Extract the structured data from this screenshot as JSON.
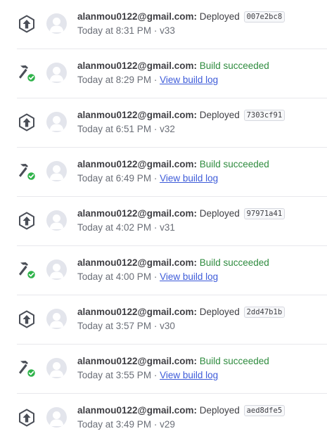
{
  "colors": {
    "success_text": "#2e8b3e",
    "link": "#3d5bd9",
    "badge_green": "#2fb34a"
  },
  "activity": [
    {
      "type": "deploy",
      "icon": "deploy-icon",
      "user": "alanmou0122@gmail.com:",
      "action": "Deployed",
      "commit": "007e2bc8",
      "time": "Today at 8:31 PM",
      "separator": "·",
      "version": "v33"
    },
    {
      "type": "build",
      "icon": "build-success-icon",
      "user": "alanmou0122@gmail.com:",
      "action": "Build succeeded",
      "time": "Today at 8:29 PM",
      "separator": "·",
      "link": "View build log"
    },
    {
      "type": "deploy",
      "icon": "deploy-icon",
      "user": "alanmou0122@gmail.com:",
      "action": "Deployed",
      "commit": "7303cf91",
      "time": "Today at 6:51 PM",
      "separator": "·",
      "version": "v32"
    },
    {
      "type": "build",
      "icon": "build-success-icon",
      "user": "alanmou0122@gmail.com:",
      "action": "Build succeeded",
      "time": "Today at 6:49 PM",
      "separator": "·",
      "link": "View build log"
    },
    {
      "type": "deploy",
      "icon": "deploy-icon",
      "user": "alanmou0122@gmail.com:",
      "action": "Deployed",
      "commit": "97971a41",
      "time": "Today at 4:02 PM",
      "separator": "·",
      "version": "v31"
    },
    {
      "type": "build",
      "icon": "build-success-icon",
      "user": "alanmou0122@gmail.com:",
      "action": "Build succeeded",
      "time": "Today at 4:00 PM",
      "separator": "·",
      "link": "View build log"
    },
    {
      "type": "deploy",
      "icon": "deploy-icon",
      "user": "alanmou0122@gmail.com:",
      "action": "Deployed",
      "commit": "2dd47b1b",
      "time": "Today at 3:57 PM",
      "separator": "·",
      "version": "v30"
    },
    {
      "type": "build",
      "icon": "build-success-icon",
      "user": "alanmou0122@gmail.com:",
      "action": "Build succeeded",
      "time": "Today at 3:55 PM",
      "separator": "·",
      "link": "View build log"
    },
    {
      "type": "deploy",
      "icon": "deploy-icon",
      "user": "alanmou0122@gmail.com:",
      "action": "Deployed",
      "commit": "aed8dfe5",
      "time": "Today at 3:49 PM",
      "separator": "·",
      "version": "v29"
    }
  ]
}
